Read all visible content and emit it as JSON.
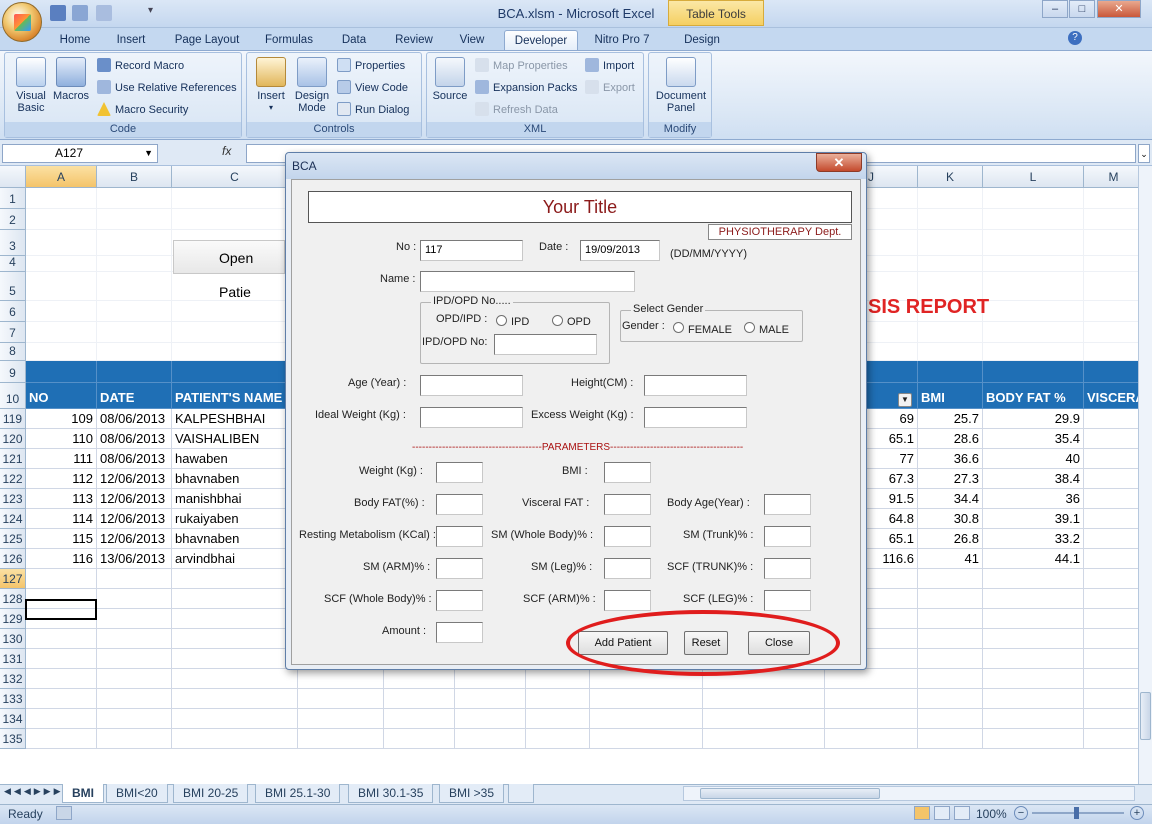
{
  "window": {
    "title": "BCA.xlsm - Microsoft Excel",
    "contextual_tab": "Table Tools",
    "min": "–",
    "max": "□",
    "close": "✕"
  },
  "ribbon_tabs": [
    "Home",
    "Insert",
    "Page Layout",
    "Formulas",
    "Data",
    "Review",
    "View",
    "Developer",
    "Nitro Pro 7",
    "Design"
  ],
  "ribbon": {
    "code": {
      "label": "Code",
      "visual_basic": [
        "Visual",
        "Basic"
      ],
      "macros": "Macros",
      "record_macro": "Record Macro",
      "relative_refs": "Use Relative References",
      "macro_security": "Macro Security"
    },
    "controls": {
      "label": "Controls",
      "insert": "Insert",
      "design_mode": [
        "Design",
        "Mode"
      ],
      "properties": "Properties",
      "view_code": "View Code",
      "run_dialog": "Run Dialog"
    },
    "xml": {
      "label": "XML",
      "source": "Source",
      "map_properties": "Map Properties",
      "expansion_packs": "Expansion Packs",
      "refresh_data": "Refresh Data",
      "import": "Import",
      "export": "Export"
    },
    "modify": {
      "label": "Modify",
      "document_panel": [
        "Document",
        "Panel"
      ]
    }
  },
  "formula_bar": {
    "name_box": "A127",
    "fx": "fx",
    "formula": ""
  },
  "columns": [
    "A",
    "B",
    "C",
    "J",
    "K",
    "L",
    "M"
  ],
  "sheet": {
    "open_patient_button": "Open Patie",
    "report_title": "SIS REPORT",
    "headers": {
      "no": "NO",
      "date": "DATE",
      "patient_name": "PATIENT'S NAME",
      "bmi": "BMI",
      "body_fat": "BODY FAT %",
      "visceral": "VISCERA"
    },
    "top_rows": [
      "1",
      "2",
      "3",
      "4",
      "5",
      "6",
      "7",
      "8",
      "9",
      "10"
    ],
    "rows": [
      {
        "row": "119",
        "no": "109",
        "date": "08/06/2013",
        "name": "KALPESHBHAI",
        "j": "69",
        "bmi": "25.7",
        "fat": "29.9"
      },
      {
        "row": "120",
        "no": "110",
        "date": "08/06/2013",
        "name": "VAISHALIBEN",
        "j": "65.1",
        "bmi": "28.6",
        "fat": "35.4"
      },
      {
        "row": "121",
        "no": "111",
        "date": "08/06/2013",
        "name": "hawaben",
        "j": "77",
        "bmi": "36.6",
        "fat": "40"
      },
      {
        "row": "122",
        "no": "112",
        "date": "12/06/2013",
        "name": "bhavnaben",
        "j": "67.3",
        "bmi": "27.3",
        "fat": "38.4"
      },
      {
        "row": "123",
        "no": "113",
        "date": "12/06/2013",
        "name": "manishbhai",
        "j": "91.5",
        "bmi": "34.4",
        "fat": "36"
      },
      {
        "row": "124",
        "no": "114",
        "date": "12/06/2013",
        "name": "rukaiyaben",
        "j": "64.8",
        "bmi": "30.8",
        "fat": "39.1"
      },
      {
        "row": "125",
        "no": "115",
        "date": "12/06/2013",
        "name": "bhavnaben",
        "j": "65.1",
        "bmi": "26.8",
        "fat": "33.2"
      },
      {
        "row": "126",
        "no": "116",
        "date": "13/06/2013",
        "name": "arvindbhai",
        "j": "116.6",
        "bmi": "41",
        "fat": "44.1"
      }
    ],
    "empty_rows": [
      "127",
      "128",
      "129",
      "130",
      "131",
      "132",
      "133",
      "134",
      "135"
    ]
  },
  "sheet_tabs": [
    "BMI",
    "BMI<20",
    "BMI 20-25",
    "BMI 25.1-30",
    "BMI 30.1-35",
    "BMI >35"
  ],
  "status": {
    "ready": "Ready",
    "zoom": "100%"
  },
  "dialog": {
    "title": "BCA",
    "form_title": "Your Title",
    "dept": "PHYSIOTHERAPY Dept.",
    "no_label": "No :",
    "no_value": "117",
    "date_label": "Date :",
    "date_value": "19/09/2013",
    "date_format": "(DD/MM/YYYY)",
    "name_label": "Name :",
    "ipd_frame": "IPD/OPD No.....",
    "opd_ipd_label": "OPD/IPD :",
    "ipd": "IPD",
    "opd": "OPD",
    "ipd_no_label": "IPD/OPD No:",
    "gender_frame": "Select Gender",
    "gender_label": "Gender :",
    "female": "FEMALE",
    "male": "MALE",
    "age": "Age (Year) :",
    "height": "Height(CM) :",
    "ideal_weight": "Ideal Weight (Kg) :",
    "excess_weight": "Excess Weight (Kg) :",
    "parameters": "---------------------------------------PARAMETERS----------------------------------------",
    "weight": "Weight (Kg) :",
    "bmi": "BMI :",
    "body_fat": "Body FAT(%) :",
    "visceral_fat": "Visceral FAT :",
    "body_age": "Body Age(Year) :",
    "resting_metabolism": "Resting Metabolism (KCal) :",
    "sm_whole": "SM (Whole Body)% :",
    "sm_trunk": "SM (Trunk)% :",
    "sm_arm": "SM (ARM)% :",
    "sm_leg": "SM (Leg)% :",
    "scf_trunk": "SCF (TRUNK)% :",
    "scf_whole": "SCF (Whole Body)% :",
    "scf_arm": "SCF (ARM)% :",
    "scf_leg": "SCF (LEG)% :",
    "amount": "Amount :",
    "add_patient": "Add Patient",
    "reset": "Reset",
    "close": "Close"
  },
  "colors": {
    "header_blue": "#1f6fb5",
    "report_red": "#e02424",
    "annotation_red": "#e01d1d",
    "dept_red": "#8b1a1a"
  }
}
